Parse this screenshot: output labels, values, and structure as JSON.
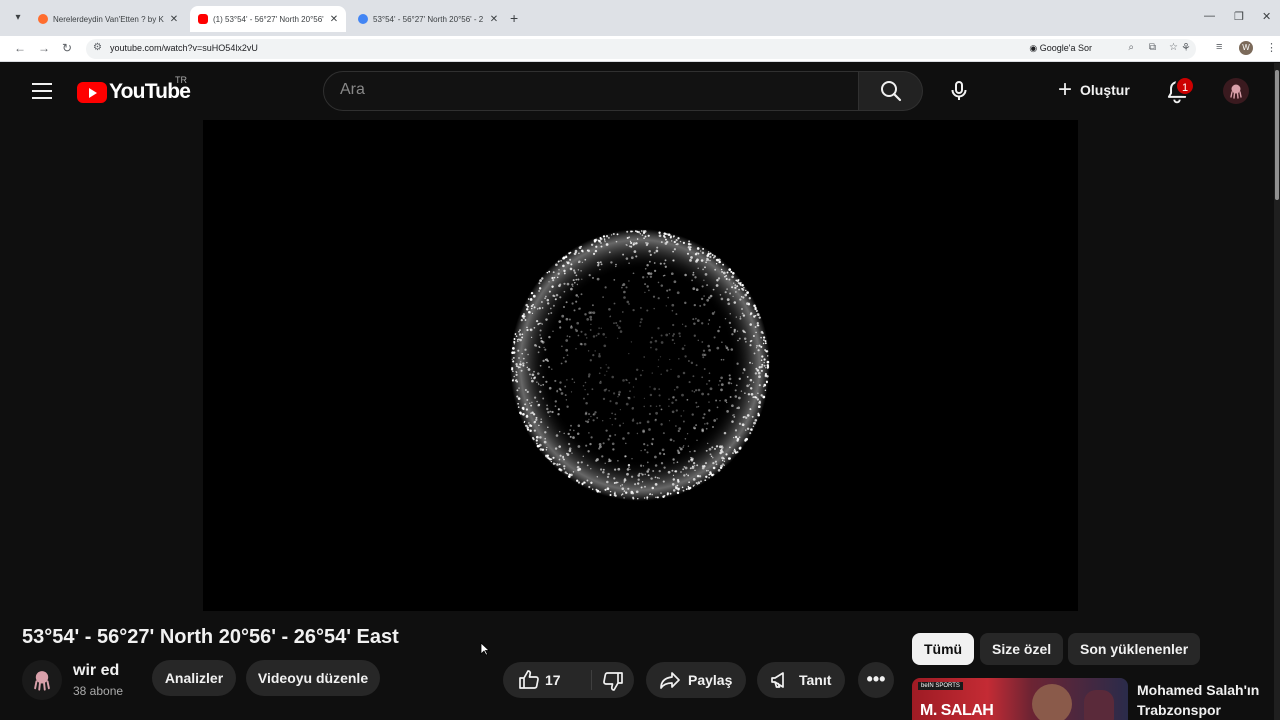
{
  "browser": {
    "tabs": [
      {
        "title": "Nerelerdeydin Van'Etten ? by K",
        "favicon_color": "#ff6d2e"
      },
      {
        "title": "(1) 53°54' - 56°27' North 20°56'",
        "favicon_color": "#ff0000"
      },
      {
        "title": "53°54' - 56°27' North 20°56' - 2",
        "favicon_color": "#4285f4"
      }
    ],
    "url": "youtube.com/watch?v=suHO54lx2vU",
    "lens_label": "Google'a Sor",
    "profile_initial": "W"
  },
  "youtube": {
    "logo_text": "YouTube",
    "country_code": "TR",
    "search_placeholder": "Ara",
    "create_label": "Oluştur",
    "notification_count": "1",
    "video": {
      "title": "53°54' - 56°27' North 20°56' - 26°54' East",
      "channel_name": "wir ed",
      "subscribers": "38 abone",
      "likes": "17"
    },
    "buttons": {
      "analytics": "Analizler",
      "edit_video": "Videoyu düzenle",
      "share": "Paylaş",
      "promote": "Tanıt"
    },
    "chips": [
      {
        "label": "Tümü",
        "active": true
      },
      {
        "label": "Size özel",
        "active": false
      },
      {
        "label": "Son yüklenenler",
        "active": false
      }
    ],
    "recommendation": {
      "title": "Mohamed Salah'ın Trabzonspor",
      "thumbnail_text": "M. SALAH",
      "thumbnail_brand": "beIN SPORTS"
    }
  },
  "colors": {
    "brand_red": "#ff0000",
    "page_bg": "#0f0f0f",
    "button_bg": "#272727"
  }
}
